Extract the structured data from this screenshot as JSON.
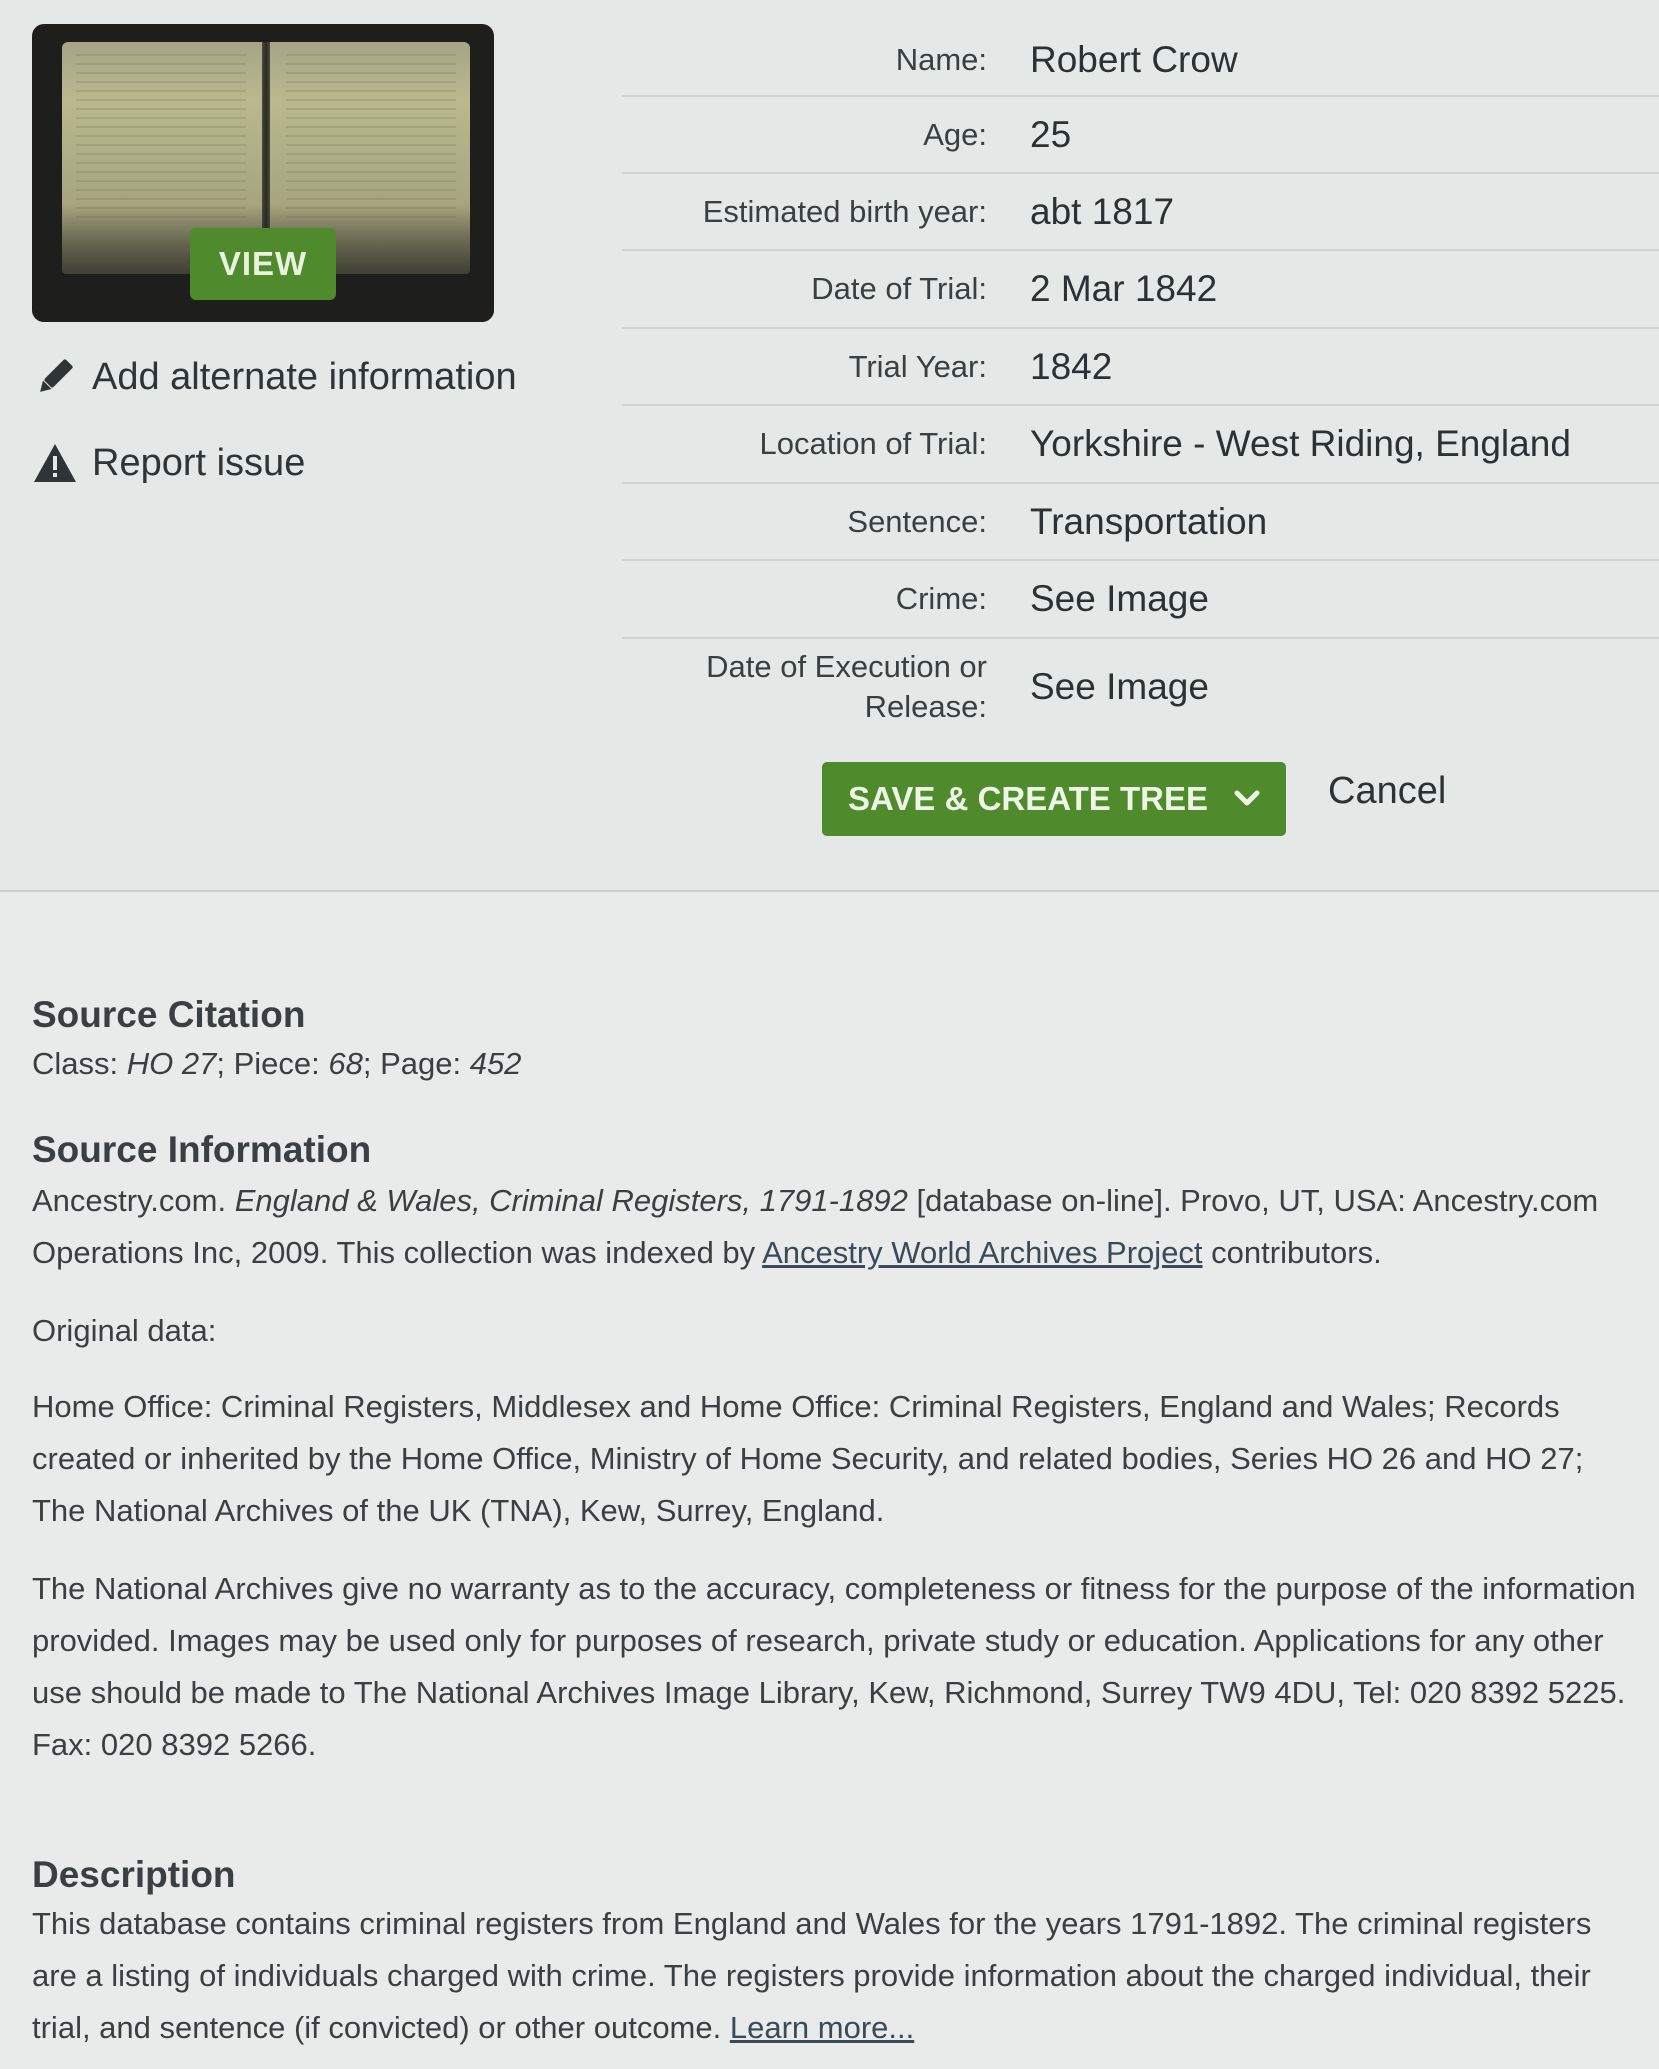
{
  "thumbnail": {
    "view_label": "VIEW"
  },
  "actions": {
    "add_alternate": "Add alternate information",
    "report_issue": "Report issue"
  },
  "record": {
    "name_label": "Name:",
    "name_value": "Robert Crow",
    "age_label": "Age:",
    "age_value": "25",
    "birth_label": "Estimated birth year:",
    "birth_value": "abt 1817",
    "trial_date_label": "Date of Trial:",
    "trial_date_value": "2 Mar 1842",
    "trial_year_label": "Trial Year:",
    "trial_year_value": "1842",
    "location_label": "Location of Trial:",
    "location_value": "Yorkshire - West Riding, England",
    "sentence_label": "Sentence:",
    "sentence_value": "Transportation",
    "crime_label": "Crime:",
    "crime_value": "See Image",
    "execution_label_line1": "Date of Execution or",
    "execution_label_line2": "Release:",
    "execution_value": "See Image"
  },
  "buttons": {
    "save_label": "SAVE & CREATE TREE",
    "cancel_label": "Cancel"
  },
  "source_citation": {
    "heading": "Source Citation",
    "class_label": "Class: ",
    "class_value": "HO 27",
    "piece_label": "; Piece: ",
    "piece_value": "68",
    "page_label": "; Page: ",
    "page_value": "452"
  },
  "source_information": {
    "heading": "Source Information",
    "text_before": "Ancestry.com. ",
    "title_italic": "England & Wales, Criminal Registers, 1791-1892",
    "text_after": " [database on-line]. Provo, UT, USA: Ancestry.com Operations Inc, 2009. This collection was indexed by ",
    "link_text": "Ancestry World Archives Project",
    "text_end": " contributors.",
    "original_data_label": "Original data:",
    "original_data_text": "Home Office: Criminal Registers, Middlesex and Home Office: Criminal Registers, England and Wales; Records created or inherited by the Home Office, Ministry of Home Security, and related bodies, Series HO 26 and HO 27; The National Archives of the UK (TNA), Kew, Surrey, England.",
    "warranty_text": "The National Archives give no warranty as to the accuracy, completeness or fitness for the purpose of the information provided. Images may be used only for purposes of research, private study or education. Applications for any other use should be made to The National Archives Image Library, Kew, Richmond, Surrey TW9 4DU, Tel: 020 8392 5225. Fax: 020 8392 5266."
  },
  "description": {
    "heading": "Description",
    "text": "This database contains criminal registers from England and Wales for the years 1791-1892. The criminal registers are a listing of individuals charged with crime. The registers provide information about the charged individual, their trial, and sentence (if convicted) or other outcome. ",
    "learn_more": "Learn more..."
  },
  "colors": {
    "brand_green": "#4f8a2c",
    "background": "#e4e8e7"
  },
  "icons": [
    "pencil-icon",
    "warning-icon",
    "chevron-down-icon"
  ]
}
